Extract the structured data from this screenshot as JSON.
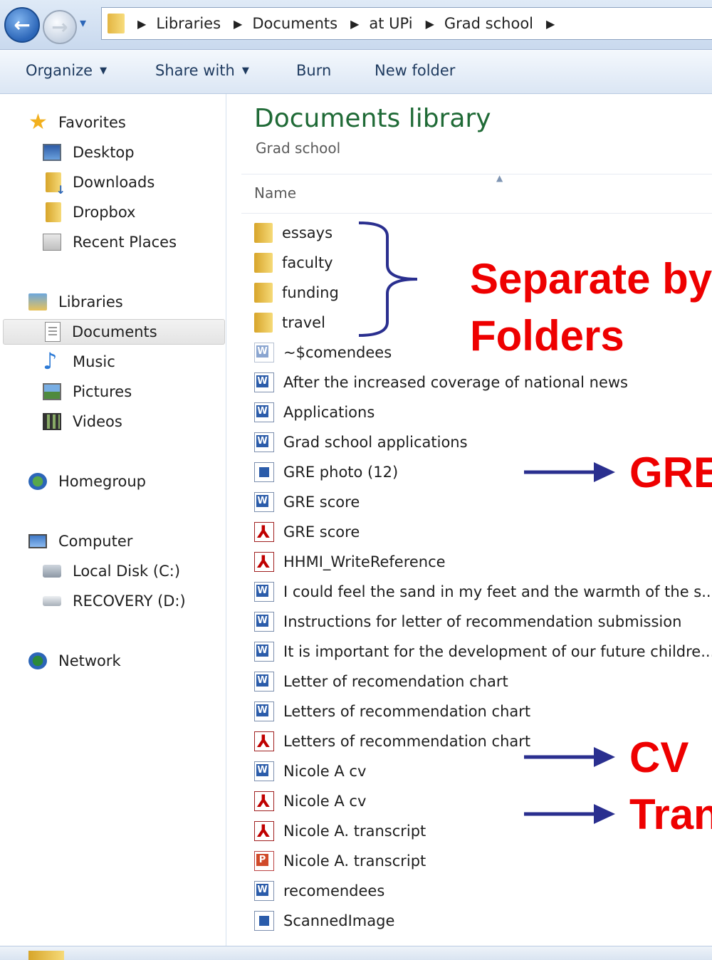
{
  "address": {
    "crumbs": [
      "Libraries",
      "Documents",
      "at UPi",
      "Grad school"
    ]
  },
  "toolbar": {
    "organize": "Organize",
    "share_with": "Share with",
    "burn": "Burn",
    "new_folder": "New folder"
  },
  "sidebar": {
    "favorites": "Favorites",
    "desktop": "Desktop",
    "downloads": "Downloads",
    "dropbox": "Dropbox",
    "recent_places": "Recent Places",
    "libraries": "Libraries",
    "documents": "Documents",
    "music": "Music",
    "pictures": "Pictures",
    "videos": "Videos",
    "homegroup": "Homegroup",
    "computer": "Computer",
    "local_disk": "Local Disk (C:)",
    "recovery": "RECOVERY (D:)",
    "network": "Network"
  },
  "main": {
    "title": "Documents library",
    "subtitle": "Grad school",
    "column_name": "Name"
  },
  "files": [
    {
      "name": "essays",
      "type": "folder"
    },
    {
      "name": "faculty",
      "type": "folder"
    },
    {
      "name": "funding",
      "type": "folder"
    },
    {
      "name": "travel",
      "type": "folder"
    },
    {
      "name": "~$comendees",
      "type": "word-temp"
    },
    {
      "name": "After the increased coverage of national news",
      "type": "word"
    },
    {
      "name": "Applications",
      "type": "word"
    },
    {
      "name": "Grad school applications",
      "type": "word"
    },
    {
      "name": "GRE photo (12)",
      "type": "image"
    },
    {
      "name": "GRE score",
      "type": "word"
    },
    {
      "name": "GRE score",
      "type": "pdf"
    },
    {
      "name": "HHMI_WriteReference",
      "type": "pdf"
    },
    {
      "name": "I could feel the sand in my feet and the warmth of the s...",
      "type": "word"
    },
    {
      "name": "Instructions for letter of recommendation submission",
      "type": "word"
    },
    {
      "name": "It is important for the development of our future childre...",
      "type": "word"
    },
    {
      "name": "Letter of recomendation chart",
      "type": "word"
    },
    {
      "name": "Letters of recommendation chart",
      "type": "word"
    },
    {
      "name": "Letters of recommendation chart",
      "type": "pdf"
    },
    {
      "name": "Nicole A cv",
      "type": "word"
    },
    {
      "name": "Nicole A cv",
      "type": "pdf"
    },
    {
      "name": "Nicole A. transcript",
      "type": "pdf"
    },
    {
      "name": "Nicole A. transcript",
      "type": "ppt"
    },
    {
      "name": "recomendees",
      "type": "word"
    },
    {
      "name": "ScannedImage",
      "type": "image"
    }
  ],
  "annotations": {
    "separate_line1": "Separate by",
    "separate_line2": "Folders",
    "gre": "GRE",
    "cv": "CV",
    "transcript": "Tran"
  },
  "colors": {
    "annotation_text": "#ee0000",
    "annotation_arrow": "#2a2f8f",
    "library_title": "#1f6a36"
  }
}
